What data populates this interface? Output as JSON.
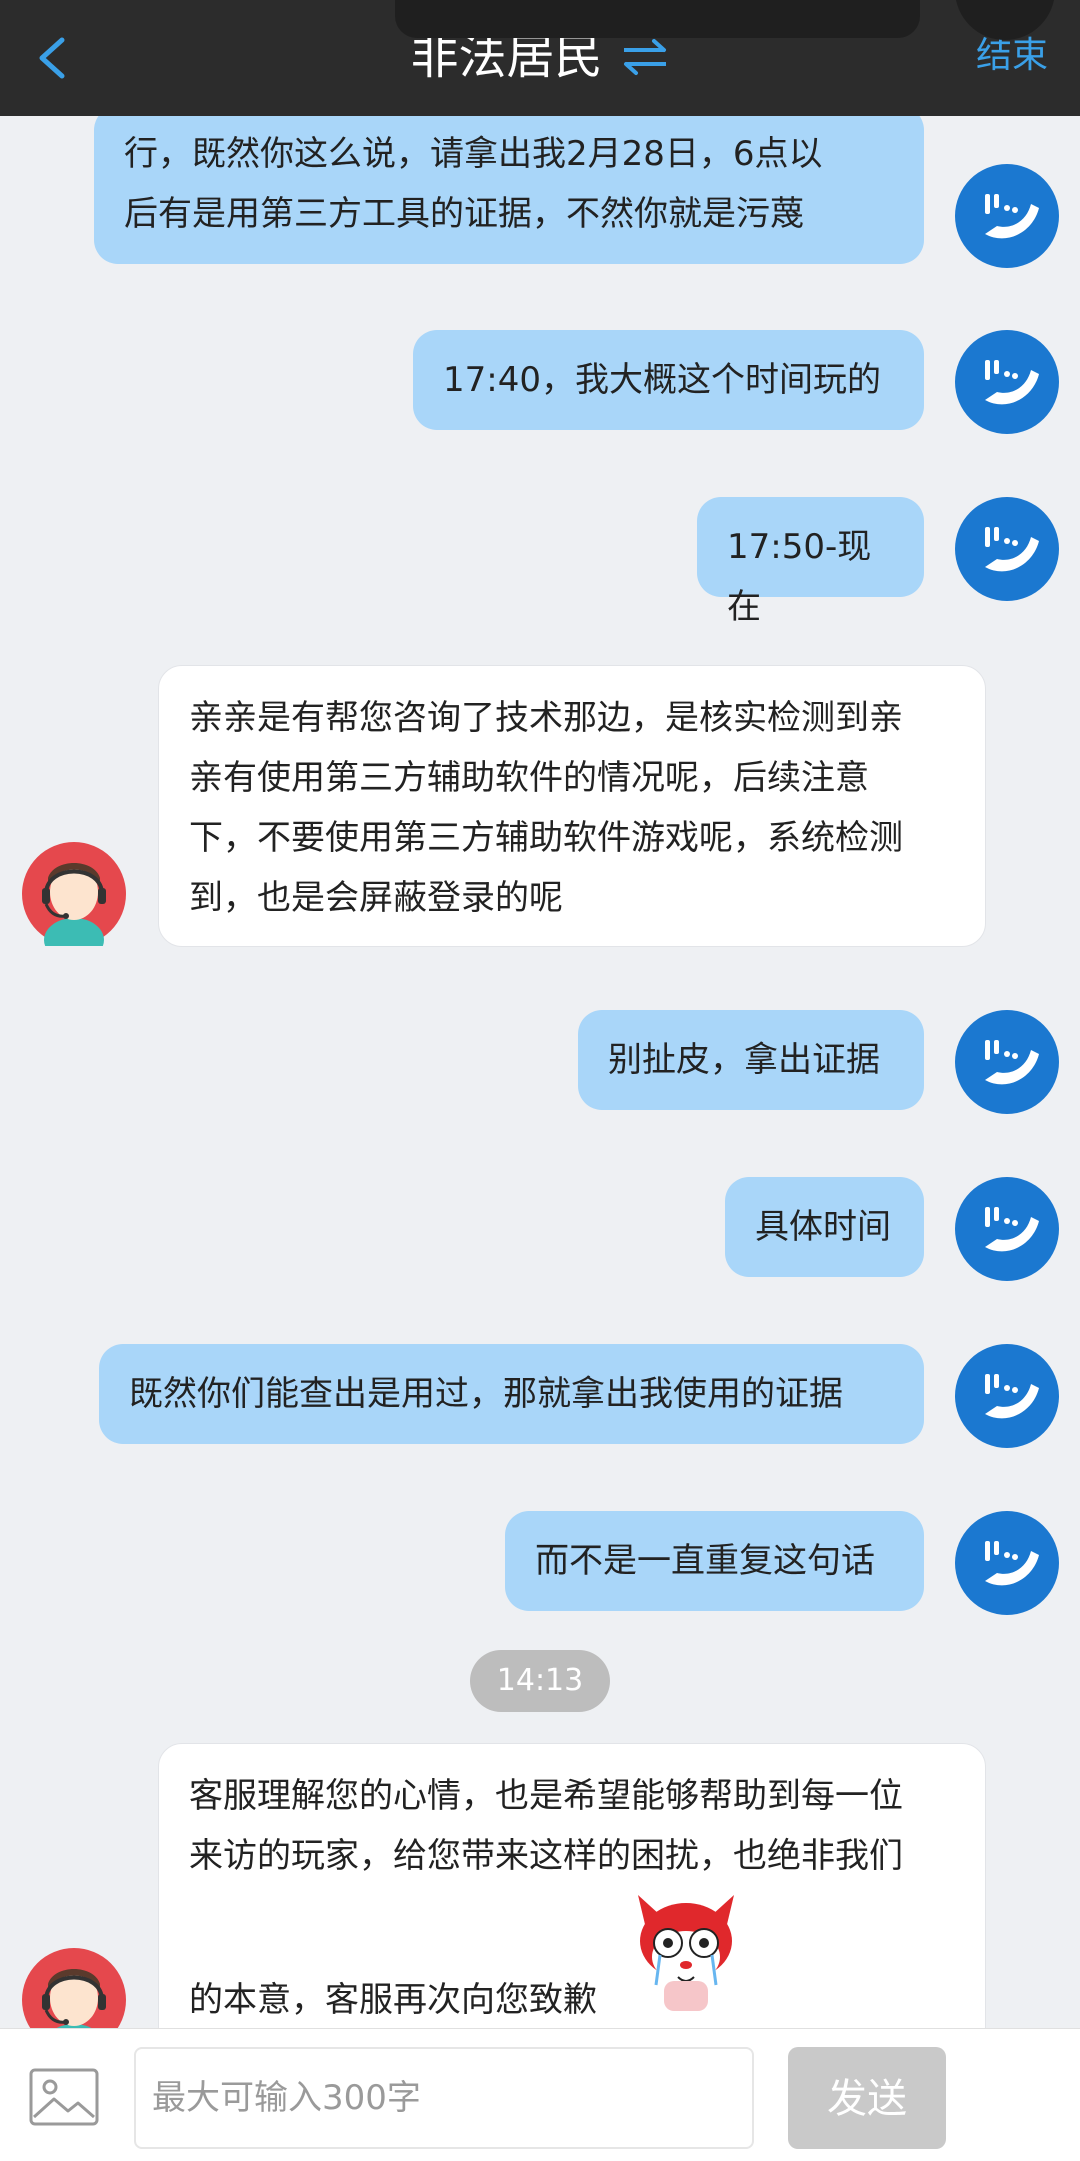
{
  "header": {
    "title": "非法居民",
    "end_label": "结束",
    "back_icon": "chevron-left-icon",
    "swap_icon": "swap-arrows-icon",
    "accent_color": "#3aa0e8"
  },
  "messages": [
    {
      "side": "out",
      "lines": [
        "行，既然你这么说，请拿出我2月28日，6点以",
        "后有是用第三方工具的证据，不然你就是污蔑"
      ]
    },
    {
      "side": "out",
      "lines": [
        "17:40，我大概这个时间玩的"
      ]
    },
    {
      "side": "out",
      "lines": [
        "17:50-现在"
      ]
    },
    {
      "side": "in",
      "lines": [
        "亲亲是有帮您咨询了技术那边，是核实检测到亲",
        "亲有使用第三方辅助软件的情况呢，后续注意",
        "下，不要使用第三方辅助软件游戏呢，系统检测",
        "到，也是会屏蔽登录的呢"
      ]
    },
    {
      "side": "out",
      "lines": [
        "别扯皮，拿出证据"
      ]
    },
    {
      "side": "out",
      "lines": [
        "具体时间"
      ]
    },
    {
      "side": "out",
      "lines": [
        "既然你们能查出是用过，那就拿出我使用的证据"
      ]
    },
    {
      "side": "out",
      "lines": [
        "而不是一直重复这句话"
      ]
    },
    {
      "side": "in",
      "lines": [
        "客服理解您的心情，也是希望能够帮助到每一位",
        "来访的玩家，给您带来这样的困扰，也绝非我们",
        "",
        "的本意，客服再次向您致歉"
      ]
    }
  ],
  "timestamp": "14:13",
  "input": {
    "placeholder": "最大可输入300字",
    "send_label": "发送",
    "image_icon": "image-icon"
  },
  "colors": {
    "outgoing_bubble": "#a9d6f9",
    "incoming_bubble": "#ffffff",
    "background": "#eef0f3",
    "header": "#2c2c2c"
  }
}
